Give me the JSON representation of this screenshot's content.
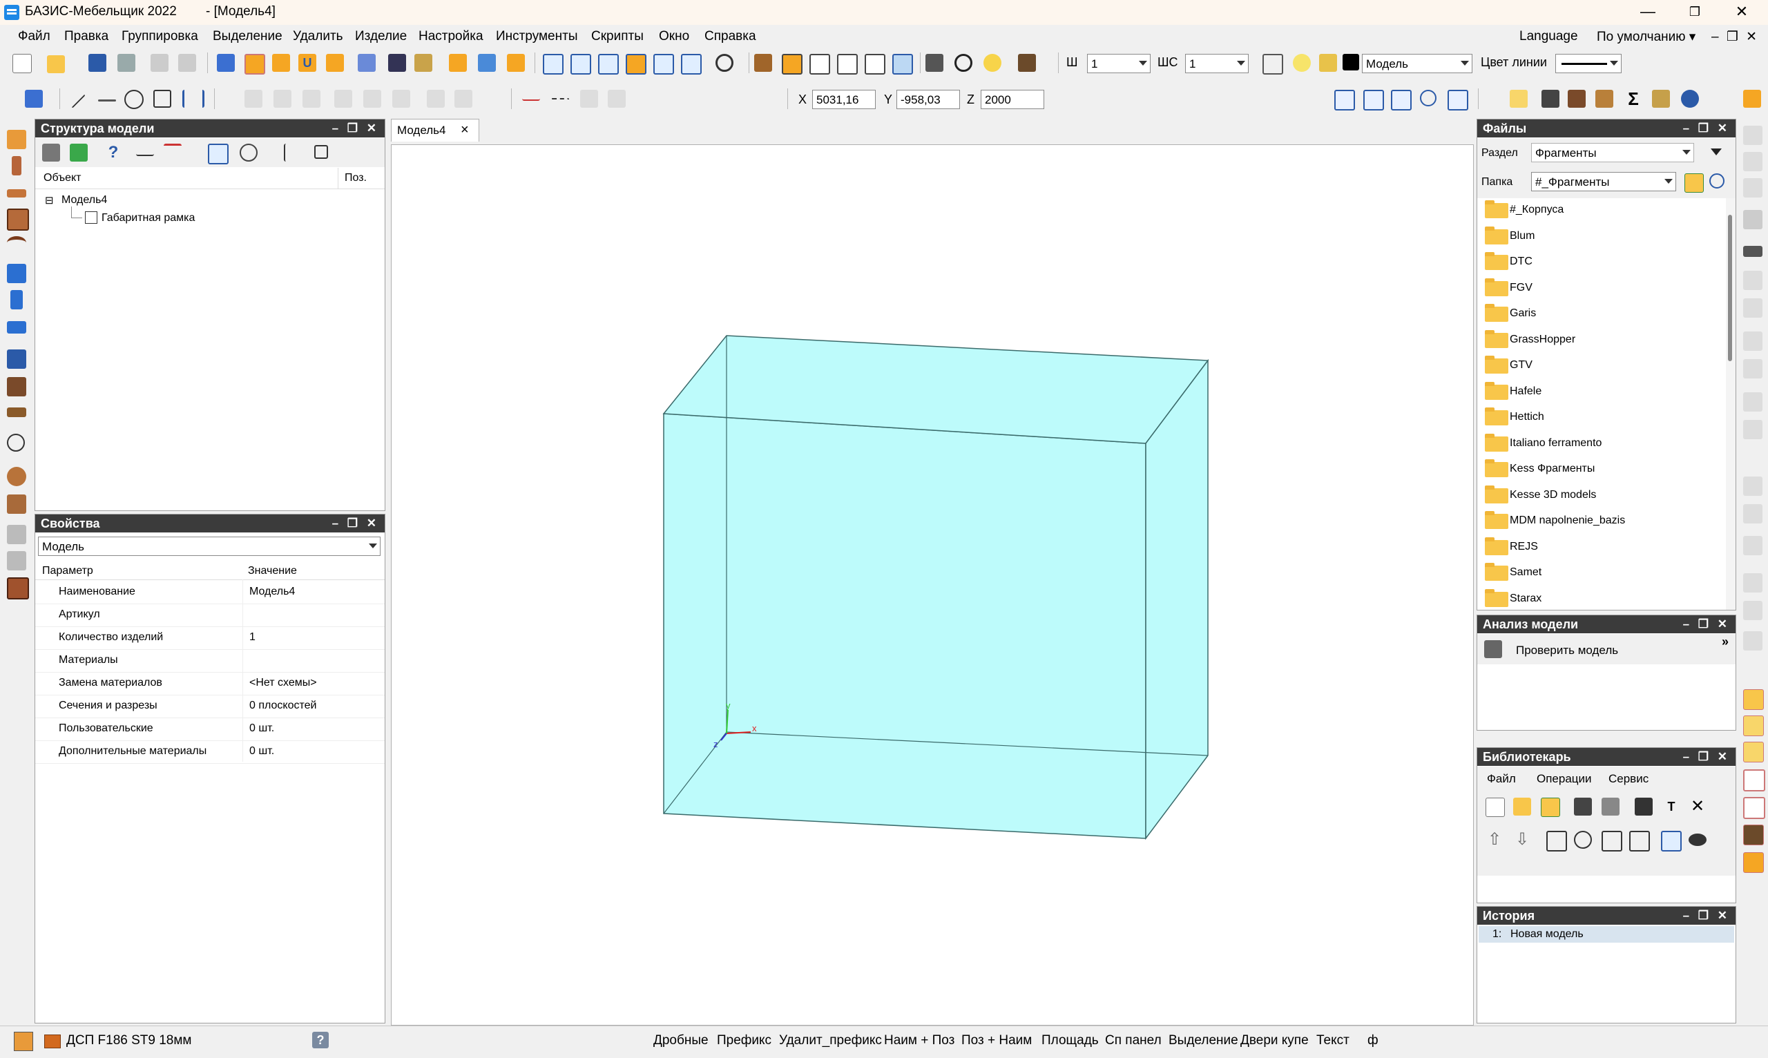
{
  "window": {
    "app_title": "БАЗИС-Мебельщик 2022",
    "doc_title": "- [Модель4]",
    "controls": [
      "—",
      "❐",
      "✕"
    ]
  },
  "menu": {
    "items": [
      "Файл",
      "Правка",
      "Группировка",
      "Выделение",
      "Удалить",
      "Изделие",
      "Настройка",
      "Инструменты",
      "Скрипты",
      "Окно",
      "Справка"
    ],
    "right": {
      "language": "Language",
      "preset": "По умолчанию ▾",
      "mdi": "– ❐ ✕"
    }
  },
  "toolbar": {
    "w_label": "Ш",
    "w_value": "1",
    "ws_label": "ШС",
    "ws_value": "1",
    "layer_value": "Модель",
    "line_color_label": "Цвет линии",
    "coords": {
      "x_label": "X",
      "x_value": "5031,16",
      "y_label": "Y",
      "y_value": "-958,03",
      "z_label": "Z",
      "z_value": "2000"
    }
  },
  "tab": {
    "label": "Модель4",
    "close": "×"
  },
  "structure_panel": {
    "title": "Структура модели",
    "col_object": "Объект",
    "col_pos": "Поз.",
    "tree_root": "Модель4",
    "tree_child": "Габаритная рамка",
    "expander": "⊟"
  },
  "properties_panel": {
    "title": "Свойства",
    "selector": "Модель",
    "col_param": "Параметр",
    "col_value": "Значение",
    "rows": [
      {
        "param": "Наименование",
        "value": "Модель4"
      },
      {
        "param": "Артикул",
        "value": ""
      },
      {
        "param": "Количество изделий",
        "value": "1"
      },
      {
        "param": "Материалы",
        "value": ""
      },
      {
        "param": "Замена материалов",
        "value": "<Нет схемы>"
      },
      {
        "param": "Сечения и разрезы",
        "value": "0 плоскостей"
      },
      {
        "param": "Пользовательские",
        "value": "0 шт."
      },
      {
        "param": "Дополнительные материалы",
        "value": "0 шт."
      }
    ]
  },
  "files_panel": {
    "title": "Файлы",
    "section_label": "Раздел",
    "section_value": "Фрагменты",
    "folder_label": "Папка",
    "folder_value": "#_Фрагменты",
    "folders": [
      "#_Корпуса",
      "Blum",
      "DTC",
      "FGV",
      "Garis",
      "GrassHopper",
      "GTV",
      "Hafele",
      "Hettich",
      "Italiano ferramento",
      "Kess Фрагменты",
      "Kesse 3D models",
      "MDM napolnenie_bazis",
      "REJS",
      "Samet",
      "Starax"
    ]
  },
  "analysis_panel": {
    "title": "Анализ модели",
    "check_label": "Проверить модель",
    "more": "»"
  },
  "librarian_panel": {
    "title": "Библиотекарь",
    "menu": [
      "Файл",
      "Операции",
      "Сервис"
    ]
  },
  "history_panel": {
    "title": "История",
    "entry_num": "1:",
    "entry_label": "Новая модель"
  },
  "panel_controls": "–  ❐  ✕",
  "axis": {
    "x": "x",
    "y": "y",
    "z": "z"
  },
  "statusbar": {
    "material": "ДСП F186 ST9 18мм",
    "help": "?",
    "items": [
      "Дробные",
      "Префикс",
      "Удалит_префикс",
      "Наим + Поз",
      "Поз + Наим",
      "Площадь",
      "Сп панел",
      "Выделение",
      "Двери купе",
      "Текст",
      "ф"
    ]
  },
  "colors": {
    "box_fill": "#bdfbfb",
    "box_edge": "#3a6a6a",
    "panel_header": "#3b3b3b",
    "folder": "#f8c64a"
  }
}
